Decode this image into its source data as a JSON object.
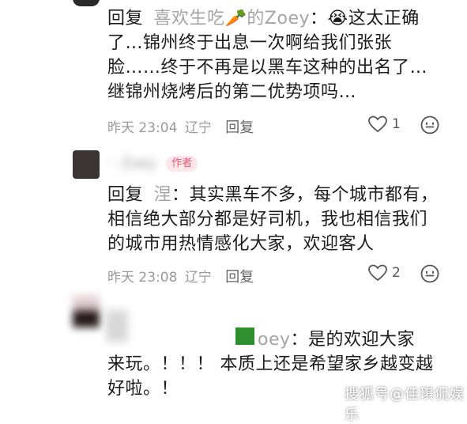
{
  "comment1": {
    "reply_prefix": "回复",
    "reply_to_name": "喜欢生吃🥕的Zoey",
    "colon": "：",
    "emoji": "😭",
    "lines": [
      "这太正确",
      "了…锦州终于出息一次啊给我们张张",
      "脸……终于不再是以黑车这种的出名了…",
      "继锦州烧烤后的第二优势项吗…"
    ],
    "time": "昨天 23:04",
    "location": "辽宁",
    "reply_label": "回复",
    "like_count": "1"
  },
  "comment2": {
    "author_blurred": "·· Zoey",
    "author_badge": "作者",
    "reply_prefix": "回复",
    "reply_to_name": "涅",
    "lines": [
      "：其实黑车不多，每个城市都有，",
      "相信绝大部分都是好司机，我也相信我们",
      "的城市用热情感化大家，欢迎客人"
    ],
    "time": "昨天 23:08",
    "location": "辽宁",
    "reply_label": "回复",
    "like_count": "2"
  },
  "comment3": {
    "name_partial": "oey",
    "lines": [
      "：是的欢迎大家",
      "来玩。！！！ 本质上还是希望家乡越变越",
      "好啦。！"
    ]
  },
  "watermark": "搜狐号@佳琪侃娱乐",
  "colors": {
    "badge_bg": "#fde7ea",
    "badge_text": "#f0566f",
    "meta_grey": "#9a9a9a",
    "reply_name_grey": "#a4a4a4",
    "censor_green": "#2f8f2f"
  }
}
